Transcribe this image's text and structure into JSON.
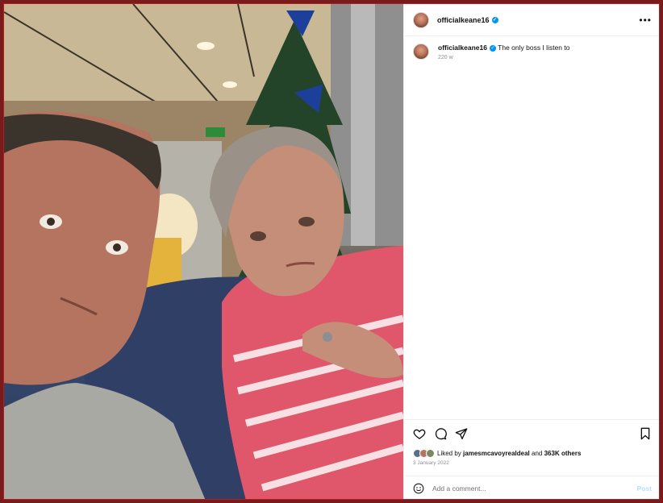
{
  "post": {
    "username": "officialkeane16",
    "caption": "The only boss I listen to",
    "age": "220 w",
    "liked_by_prefix": "Liked by",
    "liked_by_user": "jamesmcavoyrealdeal",
    "liked_by_and": "and",
    "likes_count": "363K others",
    "date": "3 January 2022"
  },
  "comment": {
    "placeholder": "Add a comment...",
    "post_label": "Post"
  },
  "icons": {
    "more": "more-horizontal-icon",
    "like": "heart-icon",
    "comment": "comment-icon",
    "share": "share-icon",
    "save": "bookmark-icon",
    "emoji": "emoji-icon"
  },
  "colors": {
    "verified": "#0095f6",
    "post_button": "#b2dffc",
    "window_border": "#b21d1d"
  }
}
